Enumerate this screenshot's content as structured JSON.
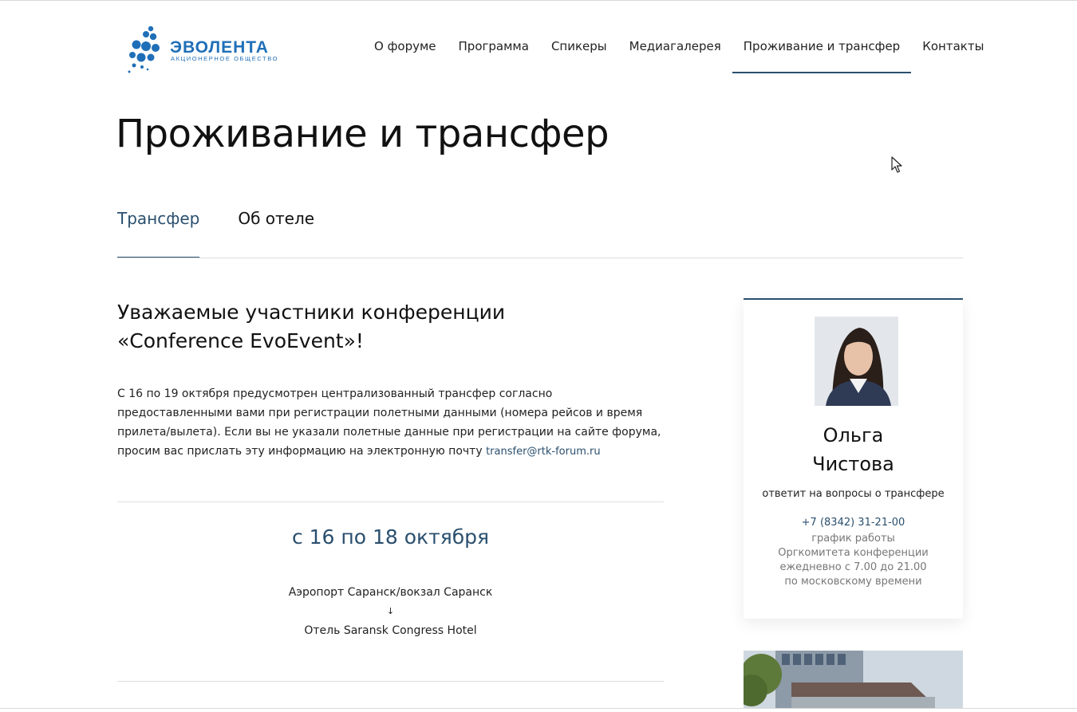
{
  "header": {
    "logo": {
      "name": "ЭВОЛЕНТА",
      "subtitle": "АКЦИОНЕРНОЕ ОБЩЕСТВО"
    },
    "nav": [
      {
        "label": "О форуме",
        "active": false
      },
      {
        "label": "Программа",
        "active": false
      },
      {
        "label": "Спикеры",
        "active": false
      },
      {
        "label": "Медиагалерея",
        "active": false
      },
      {
        "label": "Проживание и трансфер",
        "active": true
      },
      {
        "label": "Контакты",
        "active": false
      }
    ]
  },
  "page": {
    "title": "Проживание и трансфер"
  },
  "tabs": [
    {
      "label": "Трансфер",
      "active": true
    },
    {
      "label": "Об отеле",
      "active": false
    }
  ],
  "content": {
    "greeting_line1": "Уважаемые участники конференции",
    "greeting_line2": "«Conference EvoEvent»!",
    "intro_text": "С 16 по 19 октября предусмотрен централизованный трансфер согласно предоставленными вами при регистрации полетными данными (номера рейсов и время прилета/вылета). Если вы не указали полетные данные при регистрации на сайте форума, просим вас прислать эту информацию на электронную почту",
    "email": "transfer@rtk-forum.ru",
    "schedule_block": {
      "dates": "с 16 по 18 октября",
      "from": "Аэропорт Саранск/вокзал Саранск",
      "arrow": "↓",
      "to": "Отель Saransk Congress Hotel"
    }
  },
  "contact_card": {
    "first_name": "Ольга",
    "last_name": "Чистова",
    "role": "ответит на вопросы о трансфере",
    "phone": "+7 (8342) 31-21-00",
    "schedule_lines": [
      "график работы",
      "Оргкомитета конференции",
      "ежедневно с 7.00 до 21.00",
      "по московскому времени"
    ]
  },
  "colors": {
    "accent": "#2a4f6e",
    "logo_blue": "#1f6fb8",
    "divider": "#dedede"
  }
}
